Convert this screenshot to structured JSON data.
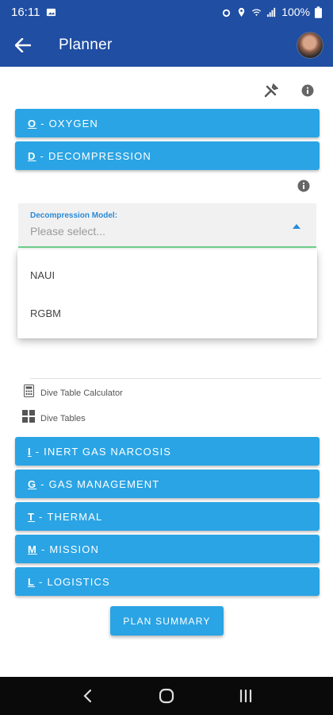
{
  "status_bar": {
    "time": "16:11",
    "battery": "100%"
  },
  "app_bar": {
    "title": "Planner"
  },
  "sections_top": [
    {
      "key": "O",
      "label": "OXYGEN"
    },
    {
      "key": "D",
      "label": "DECOMPRESSION"
    }
  ],
  "decompression_model": {
    "label": "Decompression Model:",
    "placeholder": "Please select...",
    "options": [
      "NAUI",
      "RGBM"
    ]
  },
  "tools": {
    "calculator_label": "Dive Table Calculator",
    "tables_label": "Dive Tables"
  },
  "sections_bottom": [
    {
      "key": "I",
      "label": "INERT GAS NARCOSIS"
    },
    {
      "key": "G",
      "label": "GAS MANAGEMENT"
    },
    {
      "key": "T",
      "label": "THERMAL"
    },
    {
      "key": "M",
      "label": "MISSION"
    },
    {
      "key": "L",
      "label": "LOGISTICS"
    }
  ],
  "plan_summary_label": "PLAN SUMMARY",
  "colors": {
    "primary": "#1f4ea3",
    "accent": "#2aa4e4",
    "underline": "#6fd08a"
  }
}
